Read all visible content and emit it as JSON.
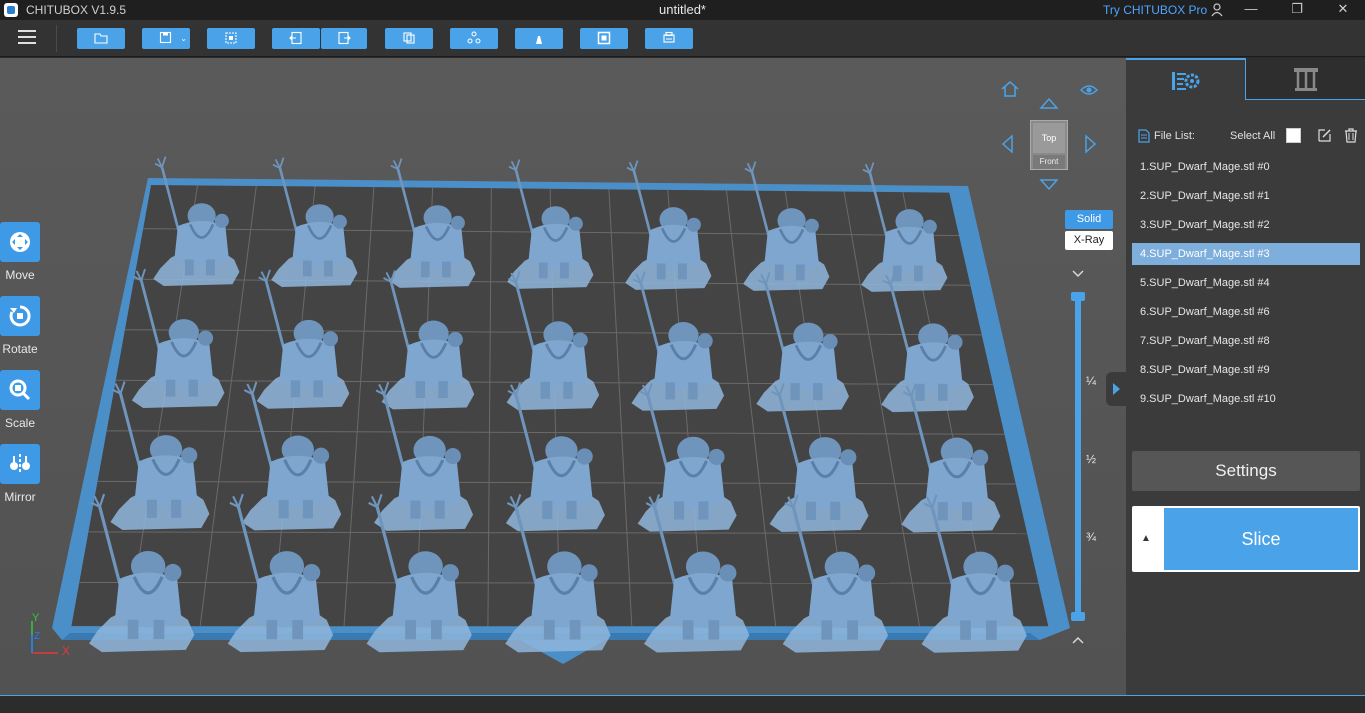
{
  "titlebar": {
    "app_name": "CHITUBOX V1.9.5",
    "document": "untitled*",
    "pro_link": "Try CHITUBOX Pro"
  },
  "toolbar": {
    "buttons": [
      "open-file-icon",
      "save-icon",
      "auto-layout-icon",
      "undo-icon",
      "redo-icon",
      "copy-icon",
      "arrange-icon",
      "support-icon",
      "hollow-icon",
      "print-icon"
    ]
  },
  "tools": [
    {
      "label": "Move",
      "icon": "move-icon"
    },
    {
      "label": "Rotate",
      "icon": "rotate-icon"
    },
    {
      "label": "Scale",
      "icon": "scale-icon"
    },
    {
      "label": "Mirror",
      "icon": "mirror-icon"
    }
  ],
  "view": {
    "cube_top": "Top",
    "cube_front": "Front",
    "solid": "Solid",
    "xray": "X-Ray"
  },
  "layer_slider": {
    "q1": "¼",
    "q2": "½",
    "q3": "¾"
  },
  "axis": {
    "x": "X",
    "y": "Y",
    "z": "Z"
  },
  "panel": {
    "file_list_label": "File List:",
    "select_all_label": "Select All",
    "files": [
      "1.SUP_Dwarf_Mage.stl #0",
      "2.SUP_Dwarf_Mage.stl #1",
      "3.SUP_Dwarf_Mage.stl #2",
      "4.SUP_Dwarf_Mage.stl #3",
      "5.SUP_Dwarf_Mage.stl #4",
      "6.SUP_Dwarf_Mage.stl #6",
      "7.SUP_Dwarf_Mage.stl #8",
      "8.SUP_Dwarf_Mage.stl #9",
      "9.SUP_Dwarf_Mage.stl #10"
    ],
    "selected_index": 3,
    "settings_label": "Settings",
    "slice_label": "Slice",
    "slice_arrow": "▲"
  },
  "colors": {
    "accent": "#4aa3e8",
    "model": "#7ea6cf",
    "plate": "#4b8fc8",
    "grid": "#444444"
  }
}
